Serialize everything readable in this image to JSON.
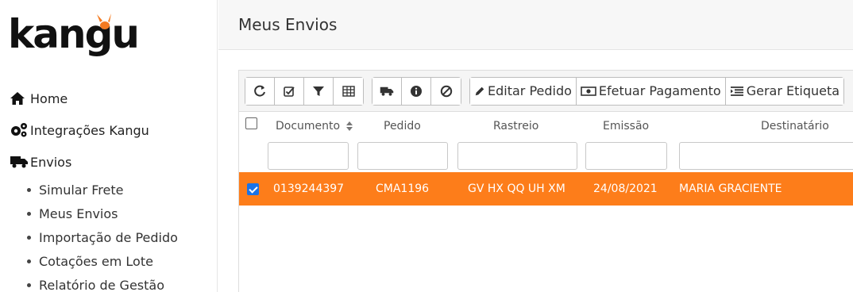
{
  "logo": {
    "text": "kangu",
    "accent": "#f47a20"
  },
  "sidebar": {
    "items": [
      {
        "label": "Home",
        "icon": "home-icon"
      },
      {
        "label": "Integrações Kangu",
        "icon": "gears-icon"
      },
      {
        "label": "Envios",
        "icon": "truck-icon"
      }
    ],
    "subitems": [
      {
        "label": "Simular Frete"
      },
      {
        "label": "Meus Envios"
      },
      {
        "label": "Importação de Pedido"
      },
      {
        "label": "Cotações em Lote"
      },
      {
        "label": "Relatório de Gestão"
      }
    ]
  },
  "header": {
    "title": "Meus Envios"
  },
  "toolbar": {
    "group1": [
      "refresh-icon",
      "check-square-icon",
      "filter-icon",
      "table-icon"
    ],
    "group2": [
      "truck-icon",
      "info-icon",
      "ban-icon"
    ],
    "actions": [
      {
        "label": "Editar Pedido",
        "icon": "pencil-icon"
      },
      {
        "label": "Efetuar Pagamento",
        "icon": "money-icon"
      },
      {
        "label": "Gerar Etiqueta",
        "icon": "list-icon"
      }
    ]
  },
  "table": {
    "columns": [
      "Documento",
      "Pedido",
      "Rastreio",
      "Emissão",
      "Destinatário"
    ],
    "rows": [
      {
        "checked": true,
        "documento": "0139244397",
        "pedido": "CMA1196",
        "rastreio": "GV HX QQ UH XM",
        "emissao": "24/08/2021",
        "destinatario": "MARIA GRACIENTE"
      }
    ]
  },
  "colors": {
    "accent": "#fd7d1a",
    "header_bg": "#f7f7f7"
  }
}
